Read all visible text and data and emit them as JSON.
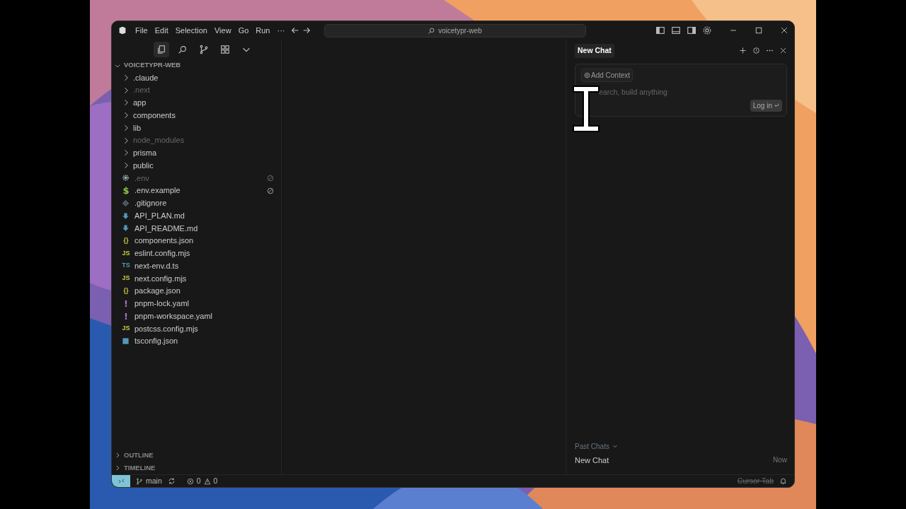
{
  "menu": [
    "File",
    "Edit",
    "Selection",
    "View",
    "Go",
    "Run",
    "···"
  ],
  "search": {
    "value": "voicetypr-web"
  },
  "explorer": {
    "title": "VOICETYPR-WEB",
    "expanded": true,
    "items": [
      {
        "kind": "folder",
        "name": ".claude",
        "dimmed": false
      },
      {
        "kind": "folder",
        "name": ".next",
        "dimmed": true
      },
      {
        "kind": "folder",
        "name": "app",
        "dimmed": false
      },
      {
        "kind": "folder",
        "name": "components",
        "dimmed": false
      },
      {
        "kind": "folder",
        "name": "lib",
        "dimmed": false
      },
      {
        "kind": "folder",
        "name": "node_modules",
        "dimmed": true
      },
      {
        "kind": "folder",
        "name": "prisma",
        "dimmed": false
      },
      {
        "kind": "folder",
        "name": "public",
        "dimmed": false
      },
      {
        "kind": "file",
        "name": ".env",
        "dimmed": true,
        "excluded": true,
        "icon": {
          "kind": "gear"
        }
      },
      {
        "kind": "file",
        "name": ".env.example",
        "dimmed": false,
        "excluded": true,
        "icon": {
          "kind": "glyph",
          "text": "$",
          "color": "#8dc149"
        }
      },
      {
        "kind": "file",
        "name": ".gitignore",
        "dimmed": false,
        "excluded": false,
        "icon": {
          "kind": "git"
        }
      },
      {
        "kind": "file",
        "name": "API_PLAN.md",
        "dimmed": false,
        "excluded": false,
        "icon": {
          "kind": "markdown"
        }
      },
      {
        "kind": "file",
        "name": "API_README.md",
        "dimmed": false,
        "excluded": false,
        "icon": {
          "kind": "markdown"
        }
      },
      {
        "kind": "file",
        "name": "components.json",
        "dimmed": false,
        "excluded": false,
        "icon": {
          "kind": "glyph",
          "text": "{}",
          "color": "#cbcb41"
        }
      },
      {
        "kind": "file",
        "name": "eslint.config.mjs",
        "dimmed": false,
        "excluded": false,
        "icon": {
          "kind": "glyph",
          "text": "JS",
          "color": "#cbcb41"
        }
      },
      {
        "kind": "file",
        "name": "next-env.d.ts",
        "dimmed": false,
        "excluded": false,
        "icon": {
          "kind": "glyph",
          "text": "TS",
          "color": "#519aba"
        }
      },
      {
        "kind": "file",
        "name": "next.config.mjs",
        "dimmed": false,
        "excluded": false,
        "icon": {
          "kind": "glyph",
          "text": "JS",
          "color": "#cbcb41"
        }
      },
      {
        "kind": "file",
        "name": "package.json",
        "dimmed": false,
        "excluded": false,
        "icon": {
          "kind": "glyph",
          "text": "{}",
          "color": "#cbcb41"
        }
      },
      {
        "kind": "file",
        "name": "pnpm-lock.yaml",
        "dimmed": false,
        "excluded": false,
        "icon": {
          "kind": "glyph",
          "text": "!",
          "color": "#a074c4"
        }
      },
      {
        "kind": "file",
        "name": "pnpm-workspace.yaml",
        "dimmed": false,
        "excluded": false,
        "icon": {
          "kind": "glyph",
          "text": "!",
          "color": "#a074c4"
        }
      },
      {
        "kind": "file",
        "name": "postcss.config.mjs",
        "dimmed": false,
        "excluded": false,
        "icon": {
          "kind": "glyph",
          "text": "JS",
          "color": "#cbcb41"
        }
      },
      {
        "kind": "file",
        "name": "tsconfig.json",
        "dimmed": false,
        "excluded": false,
        "icon": {
          "kind": "tsconfig"
        }
      }
    ],
    "sections": [
      {
        "title": "OUTLINE",
        "expanded": false
      },
      {
        "title": "TIMELINE",
        "expanded": false
      }
    ]
  },
  "chat": {
    "tab": "New Chat",
    "context_button": "Add Context",
    "placeholder": "earch, build anything",
    "login_button": "Log in",
    "past_chats_label": "Past Chats",
    "past_chats": [
      {
        "title": "New Chat",
        "time": "Now"
      }
    ]
  },
  "status_bar": {
    "branch": "main",
    "errors": "0",
    "warnings": "0",
    "cursor_tab": "Cursor Tab",
    "cursor_tab_disabled": true
  }
}
